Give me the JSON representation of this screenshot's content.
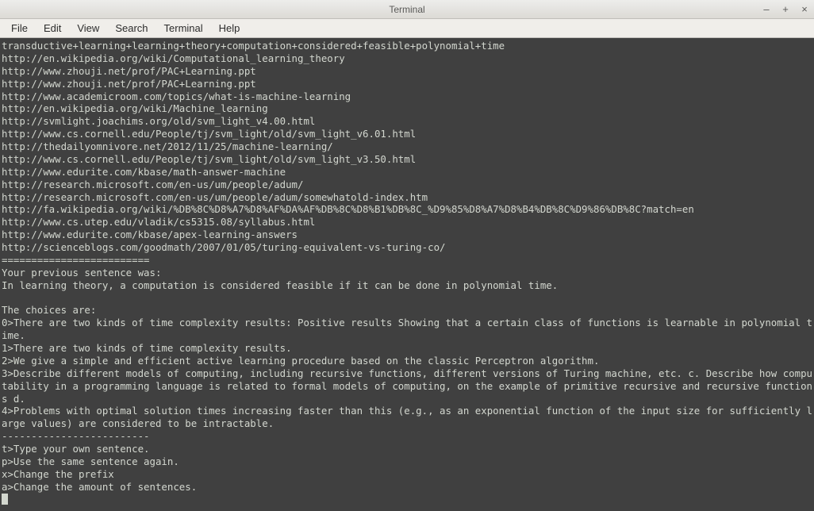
{
  "window": {
    "title": "Terminal",
    "controls": {
      "min": "–",
      "max": "+",
      "close": "×"
    }
  },
  "menubar": [
    "File",
    "Edit",
    "View",
    "Search",
    "Terminal",
    "Help"
  ],
  "terminal": {
    "urls": [
      "transductive+learning+learning+theory+computation+considered+feasible+polynomial+time",
      "http://en.wikipedia.org/wiki/Computational_learning_theory",
      "http://www.zhouji.net/prof/PAC+Learning.ppt",
      "http://www.zhouji.net/prof/PAC+Learning.ppt",
      "http://www.academicroom.com/topics/what-is-machine-learning",
      "http://en.wikipedia.org/wiki/Machine_learning",
      "http://svmlight.joachims.org/old/svm_light_v4.00.html",
      "http://www.cs.cornell.edu/People/tj/svm_light/old/svm_light_v6.01.html",
      "http://thedailyomnivore.net/2012/11/25/machine-learning/",
      "http://www.cs.cornell.edu/People/tj/svm_light/old/svm_light_v3.50.html",
      "http://www.edurite.com/kbase/math-answer-machine",
      "http://research.microsoft.com/en-us/um/people/adum/",
      "http://research.microsoft.com/en-us/um/people/adum/somewhatold-index.htm",
      "http://fa.wikipedia.org/wiki/%DB%8C%D8%A7%D8%AF%DA%AF%DB%8C%D8%B1%DB%8C_%D9%85%D8%A7%D8%B4%DB%8C%D9%86%DB%8C?match=en",
      "http://www.cs.utep.edu/vladik/cs5315.08/syllabus.html",
      "http://www.edurite.com/kbase/apex-learning-answers",
      "http://scienceblogs.com/goodmath/2007/01/05/turing-equivalent-vs-turing-co/"
    ],
    "divider1": "=========================",
    "prev_sentence_label": "Your previous sentence was:",
    "prev_sentence": "In learning theory, a computation is considered feasible if it can be done in polynomial time.",
    "choices_label": "The choices are:",
    "choices": [
      "0>There are two kinds of time complexity results: Positive results Showing that a certain class of functions is learnable in polynomial time.",
      "1>There are two kinds of time complexity results.",
      "2>We give a simple and efficient active learning procedure based on the classic Perceptron algorithm.",
      "3>Describe different models of computing, including recursive functions, different versions of Turing machine, etc. c. Describe how computability in a programming language is related to formal models of computing, on the example of primitive recursive and recursive functions d.",
      "4>Problems with optimal solution times increasing faster than this (e.g., as an exponential function of the input size for sufficiently large values) are considered to be intractable."
    ],
    "divider2": "-------------------------",
    "options": [
      "t>Type your own sentence.",
      "p>Use the same sentence again.",
      "x>Change the prefix",
      "a>Change the amount of sentences."
    ]
  }
}
